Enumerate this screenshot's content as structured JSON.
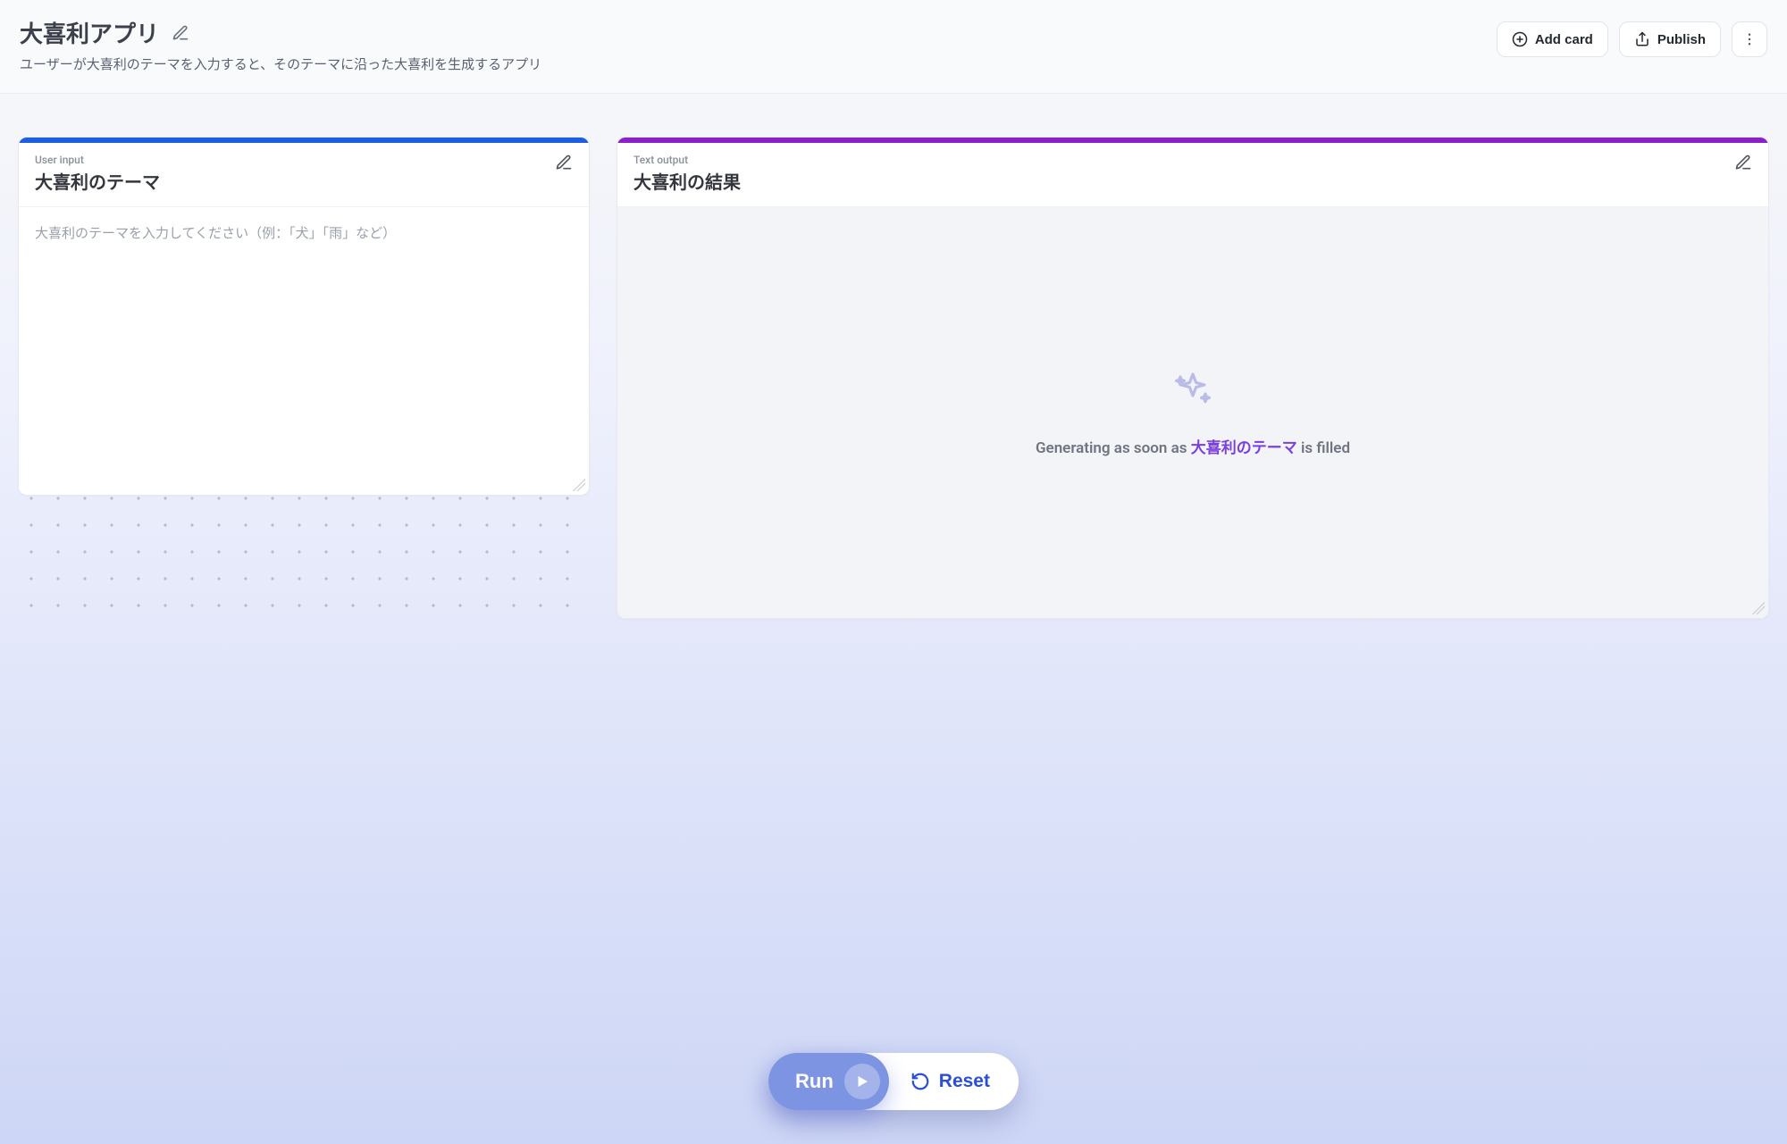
{
  "header": {
    "title": "大喜利アプリ",
    "subtitle": "ユーザーが大喜利のテーマを入力すると、そのテーマに沿った大喜利を生成するアプリ",
    "add_card_label": "Add card",
    "publish_label": "Publish"
  },
  "input_card": {
    "type_label": "User input",
    "title": "大喜利のテーマ",
    "placeholder": "大喜利のテーマを入力してください（例：「犬」「雨」など）",
    "value": ""
  },
  "output_card": {
    "type_label": "Text output",
    "title": "大喜利の結果",
    "generating_prefix": "Generating as soon as ",
    "generating_ref": "大喜利のテーマ",
    "generating_suffix": " is filled"
  },
  "footer": {
    "run_label": "Run",
    "reset_label": "Reset"
  }
}
